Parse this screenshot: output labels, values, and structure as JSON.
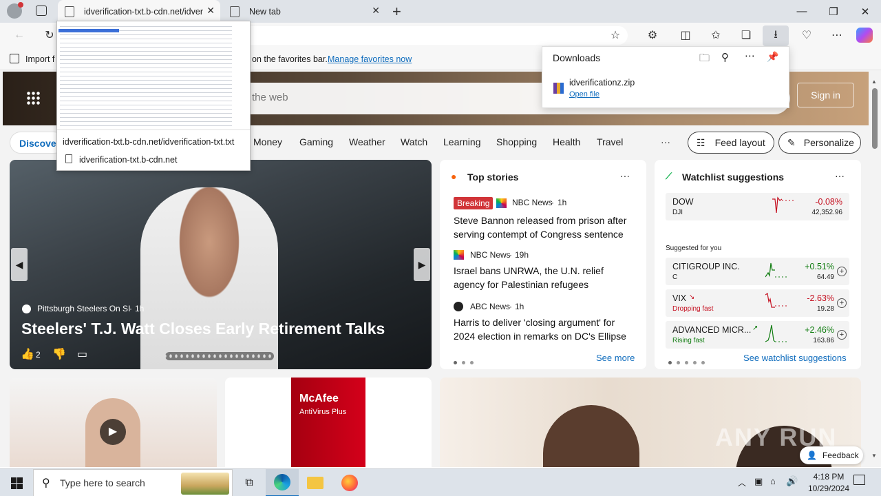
{
  "tabs": [
    {
      "title": "idverification-txt.b-cdn.net/idver"
    },
    {
      "title": "New tab"
    }
  ],
  "favbar": {
    "import_label": "Import f",
    "hint": "on the favorites bar.",
    "manage_link": "Manage favorites now"
  },
  "link_popup": {
    "url": "idverification-txt.b-cdn.net/idverification-txt.txt",
    "host": "idverification-txt.b-cdn.net"
  },
  "downloads": {
    "title": "Downloads",
    "file_name": "idverificationz.zip",
    "open_label": "Open file"
  },
  "hero": {
    "search_placeholder": "the web",
    "signin": "Sign in"
  },
  "nav": {
    "discover": "Discover",
    "items": [
      "Money",
      "Gaming",
      "Weather",
      "Watch",
      "Learning",
      "Shopping",
      "Health",
      "Travel"
    ],
    "more": "···",
    "feed_layout": "Feed layout",
    "personalize": "Personalize"
  },
  "hero_story": {
    "source": "Pittsburgh Steelers On SI",
    "age": "1h",
    "headline": "Steelers' T.J. Watt Closes Early Retirement Talks",
    "likes": "2"
  },
  "top_stories": {
    "title": "Top stories",
    "more": "···",
    "items": [
      {
        "badge": "Breaking",
        "source": "NBC News",
        "age": "1h",
        "headline": "Steve Bannon released from prison after serving contempt of Congress sentence"
      },
      {
        "source": "NBC News",
        "age": "19h",
        "headline": "Israel bans UNRWA, the U.N. relief agency for Palestinian refugees"
      },
      {
        "source": "ABC News",
        "age": "1h",
        "headline": "Harris to deliver 'closing argument' for 2024 election in remarks on DC's Ellipse"
      }
    ],
    "see_more": "See more"
  },
  "watchlist": {
    "title": "Watchlist suggestions",
    "more": "···",
    "index": {
      "name": "DOW",
      "symbol": "DJI",
      "change": "-0.08%",
      "price": "42,352.96"
    },
    "suggested_label": "Suggested for you",
    "stocks": [
      {
        "name": "CITIGROUP INC.",
        "sub": "C",
        "change": "+0.51%",
        "price": "64.49"
      },
      {
        "name": "VIX",
        "sub": "Dropping fast",
        "change": "-2.63%",
        "price": "19.28"
      },
      {
        "name": "ADVANCED MICR...",
        "sub": "Rising fast",
        "change": "+2.46%",
        "price": "163.86"
      }
    ],
    "see_link": "See watchlist suggestions"
  },
  "promo": {
    "brand": "McAfee",
    "product": "AntiVirus Plus"
  },
  "feedback": "Feedback",
  "watermark": "ANY RUN",
  "taskbar": {
    "search_placeholder": "Type here to search",
    "time": "4:18 PM",
    "date": "10/29/2024"
  },
  "colors": {
    "accent": "#0f6cbd",
    "negative": "#c50f1f",
    "positive": "#107c10",
    "breaking": "#d13438"
  }
}
